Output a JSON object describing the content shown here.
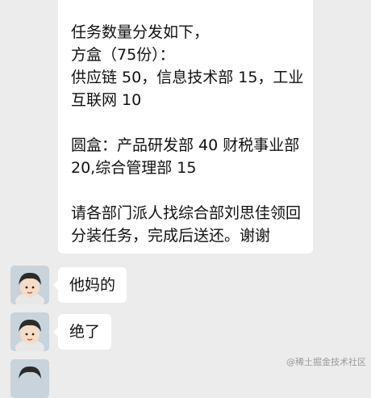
{
  "chat": {
    "announcement": {
      "lines": [
        "任务数量分发如下，",
        "方盒（75份）：",
        "供应链 50，信息技术部 15，工业",
        "互联网 10",
        "",
        "圆盒：产品研发部 40 财税事业部",
        "20,综合管理部 15",
        "",
        "请各部门派人找综合部刘思佳领回",
        "分装任务，完成后送还。谢谢"
      ]
    },
    "messages": [
      {
        "text": "他妈的"
      },
      {
        "text": "绝了"
      }
    ]
  },
  "watermark": "@稀土掘金技术社区"
}
